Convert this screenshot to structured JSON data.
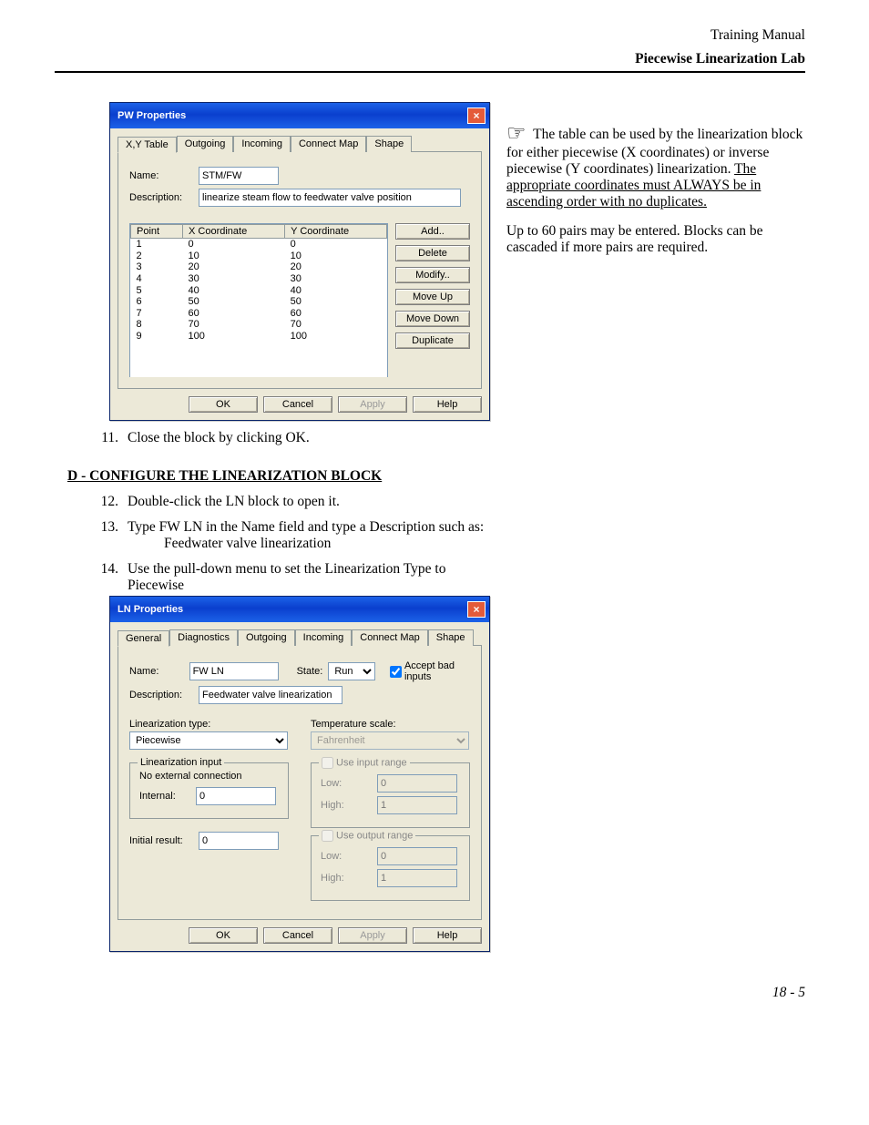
{
  "header": {
    "title": "Training Manual",
    "subtitle": "Piecewise Linearization Lab"
  },
  "footer": {
    "page": "18 - 5"
  },
  "pw": {
    "title": "PW Properties",
    "tabs": [
      "X,Y Table",
      "Outgoing",
      "Incoming",
      "Connect Map",
      "Shape"
    ],
    "name_label": "Name:",
    "name_value": "STM/FW",
    "desc_label": "Description:",
    "desc_value": "linearize steam flow to feedwater valve position",
    "col_point": "Point",
    "col_x": "X Coordinate",
    "col_y": "Y Coordinate",
    "rows": [
      {
        "n": "1",
        "x": "0",
        "y": "0"
      },
      {
        "n": "2",
        "x": "10",
        "y": "10"
      },
      {
        "n": "3",
        "x": "20",
        "y": "20"
      },
      {
        "n": "4",
        "x": "30",
        "y": "30"
      },
      {
        "n": "5",
        "x": "40",
        "y": "40"
      },
      {
        "n": "6",
        "x": "50",
        "y": "50"
      },
      {
        "n": "7",
        "x": "60",
        "y": "60"
      },
      {
        "n": "8",
        "x": "70",
        "y": "70"
      },
      {
        "n": "9",
        "x": "100",
        "y": "100"
      }
    ],
    "btn_add": "Add..",
    "btn_delete": "Delete",
    "btn_modify": "Modify..",
    "btn_moveup": "Move Up",
    "btn_movedown": "Move Down",
    "btn_duplicate": "Duplicate",
    "btn_ok": "OK",
    "btn_cancel": "Cancel",
    "btn_apply": "Apply",
    "btn_help": "Help"
  },
  "sidenote": {
    "p1a": "The table can be used by the linearization block for either piecewise (X coordinates) or inverse piecewise (Y coordinates) linearization.  ",
    "p1b": "The appropriate coordinates must ALWAYS be in ascending order with no duplicates.",
    "p2": "Up to 60 pairs may be entered.  Blocks can be cascaded if more pairs are required."
  },
  "steps": {
    "s11": "Close the block by clicking OK.",
    "section_d": "D - CONFIGURE THE LINEARIZATION BLOCK",
    "s12": "Double-click the LN block to open it.",
    "s13a": "Type  FW LN  in the Name field and type a Description such as:",
    "s13b": "Feedwater valve linearization",
    "s14a": "Use the pull-down menu to set the Linearization Type to",
    "s14b": "Piecewise"
  },
  "ln": {
    "title": "LN Properties",
    "tabs": [
      "General",
      "Diagnostics",
      "Outgoing",
      "Incoming",
      "Connect Map",
      "Shape"
    ],
    "name_label": "Name:",
    "name_value": "FW LN",
    "state_label": "State:",
    "state_value": "Run",
    "accept_label": "Accept bad inputs",
    "desc_label": "Description:",
    "desc_value": "Feedwater valve linearization",
    "lin_type_label": "Linearization type:",
    "lin_type_value": "Piecewise",
    "temp_scale_label": "Temperature scale:",
    "temp_scale_value": "Fahrenheit",
    "lin_input_legend": "Linearization input",
    "noconn": "No external connection",
    "internal_label": "Internal:",
    "internal_value": "0",
    "initial_label": "Initial result:",
    "initial_value": "0",
    "use_input_legend": "Use input range",
    "use_output_legend": "Use output range",
    "low_label": "Low:",
    "high_label": "High:",
    "input_low": "0",
    "input_high": "1",
    "output_low": "0",
    "output_high": "1",
    "btn_ok": "OK",
    "btn_cancel": "Cancel",
    "btn_apply": "Apply",
    "btn_help": "Help"
  }
}
